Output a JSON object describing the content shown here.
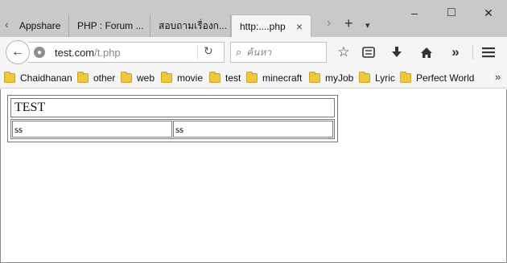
{
  "tabs": [
    {
      "label": "Appshare",
      "active": false
    },
    {
      "label": "PHP : Forum ...",
      "active": false
    },
    {
      "label": "สอบถามเรื่องก...",
      "active": false
    },
    {
      "label": "http:....php",
      "active": true
    }
  ],
  "tab_controls": {
    "scroll_left": "‹",
    "scroll_right": "›",
    "new_tab": "+",
    "list_all": "▾",
    "close_tab": "×"
  },
  "window_controls": {
    "minimize": "–",
    "maximize": "□",
    "close": "✕"
  },
  "navbar": {
    "back": "←",
    "url_host": "test.com",
    "url_path": "/t.php",
    "reload": "↻",
    "search_placeholder": "ค้นหา",
    "icons": [
      "star-icon",
      "reading-list-icon",
      "download-icon",
      "home-icon",
      "overflow-chevron-icon",
      "hamburger-menu-icon"
    ]
  },
  "bookmarks": [
    {
      "label": "Chaidhanan"
    },
    {
      "label": "other"
    },
    {
      "label": "web"
    },
    {
      "label": "movie"
    },
    {
      "label": "test"
    },
    {
      "label": "minecraft"
    },
    {
      "label": "myJob"
    },
    {
      "label": "Lyric"
    },
    {
      "label": "Perfect World"
    }
  ],
  "bookmarks_more": "»",
  "page": {
    "table_title": "TEST",
    "cells": [
      "ss",
      "ss"
    ]
  }
}
